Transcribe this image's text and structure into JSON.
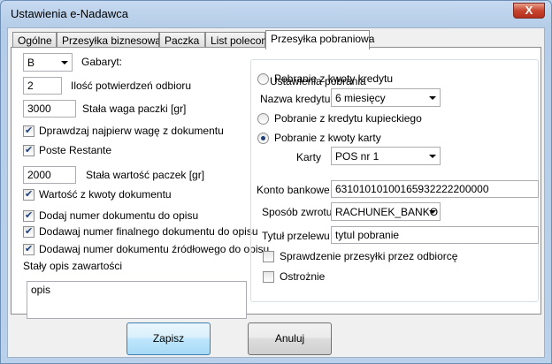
{
  "window": {
    "title": "Ustawienia e-Nadawca",
    "close_label": "X"
  },
  "tabs": [
    {
      "label": "Ogólne"
    },
    {
      "label": "Przesyłka biznesowa"
    },
    {
      "label": "Paczka"
    },
    {
      "label": "List polecony"
    },
    {
      "label": "Przesyłka pobraniowa"
    }
  ],
  "left": {
    "gabaryt_value": "B",
    "gabaryt_label": "Gabaryt:",
    "potwierdzen_value": "2",
    "potwierdzen_label": "Ilość potwierdzeń odbioru",
    "waga_value": "3000",
    "waga_label": "Stała waga paczki [gr]",
    "cb_waga_label": "Dprawdzaj najpierw wagę z dokumentu",
    "cb_poste_label": "Poste Restante",
    "wartosc_value": "2000",
    "wartosc_label": "Stała wartość paczek [gr]",
    "cb_wartosc_label": "Wartość z kwoty dokumentu",
    "cb_numer_label": "Dodaj numer dokumentu do opisu",
    "cb_numer_final_label": "Dodawaj numer finalnego dokumentu do opisu",
    "cb_numer_zrodl_label": "Dodawaj numer dokumentu źródłowego do opisu",
    "opis_label": "Stały opis zawartości",
    "opis_value": "opis"
  },
  "right": {
    "group_title": "Ustawienia pobrania",
    "rb_kredyt_label": "Pobranie z kwoty kredytu",
    "nazwa_kredytu_label": "Nazwa kredytu",
    "nazwa_kredytu_value": "6 miesięcy",
    "rb_kupiecki_label": "Pobranie z kredytu kupieckiego",
    "rb_karta_label": "Pobranie z kwoty karty",
    "karty_label": "Karty",
    "karty_value": "POS nr 1",
    "konto_label": "Konto bankowe",
    "konto_value": "63101010100165932222200000",
    "sposob_label": "Sposób zwrotu",
    "sposob_value": "RACHUNEK_BANKO",
    "tytul_label": "Tytuł przelewu",
    "tytul_value": "tytul pobranie",
    "cb_sprawdzenie_label": "Sprawdzenie przesyłki przez odbiorcę",
    "cb_ostroznie_label": "Ostrożnie"
  },
  "buttons": {
    "save_label": "Zapisz",
    "cancel_label": "Anuluj"
  }
}
